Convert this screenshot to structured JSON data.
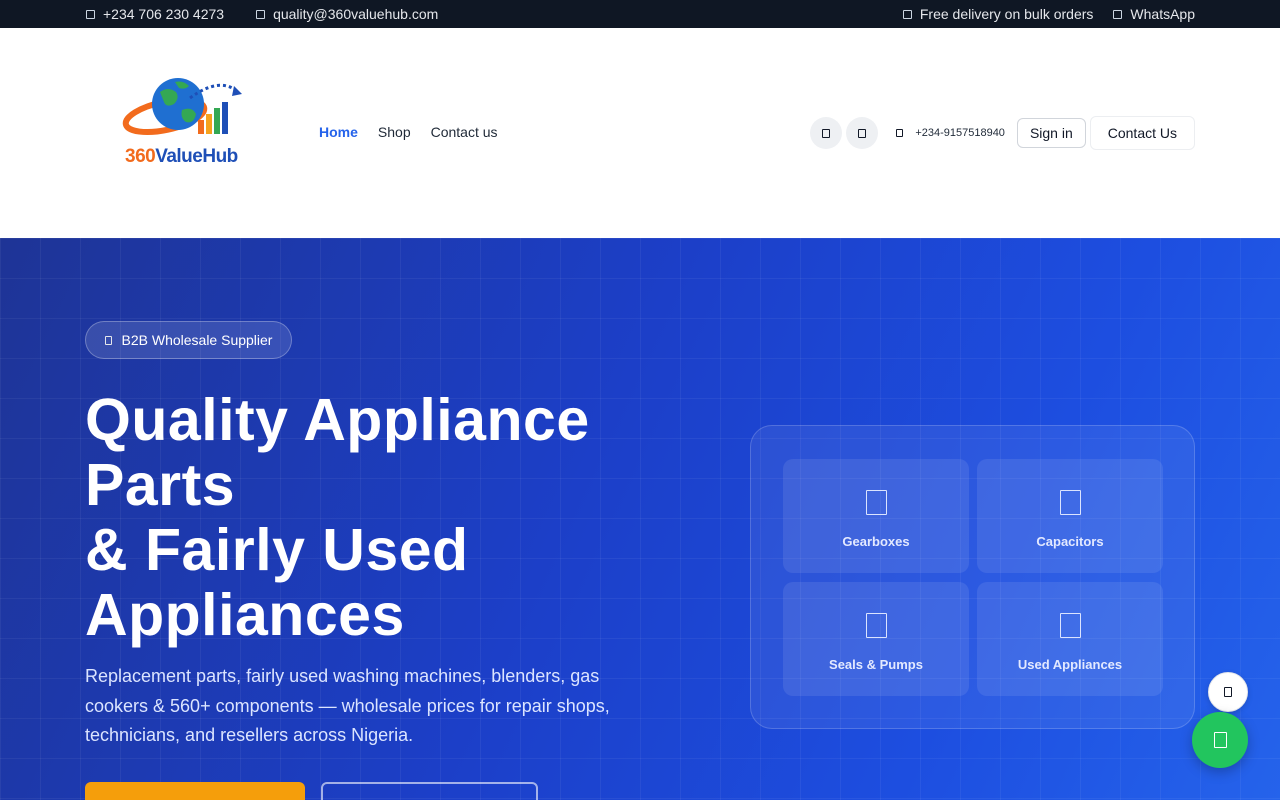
{
  "topbar": {
    "phone": "+234 706 230 4273",
    "email": "quality@360valuehub.com",
    "delivery": "Free delivery on bulk orders",
    "whatsapp": "WhatsApp"
  },
  "header": {
    "logo_part1": "360",
    "logo_part2": "ValueHub",
    "nav": [
      "Home",
      "Shop",
      "Contact us"
    ],
    "phone": "+234-9157518940",
    "signin": "Sign in",
    "contact": "Contact Us"
  },
  "hero": {
    "badge": "B2B Wholesale Supplier",
    "title_lines": [
      "Quality Appliance",
      "Parts",
      "& Fairly Used",
      "Appliances"
    ],
    "description": "Replacement parts, fairly used washing machines, blenders, gas cookers & 560+ components — wholesale prices for repair shops, technicians, and resellers across Nigeria.",
    "categories": [
      "Gearboxes",
      "Capacitors",
      "Seals & Pumps",
      "Used Appliances"
    ]
  },
  "colors": {
    "topbar_bg": "#0f1724",
    "accent": "#2563eb",
    "hero_blue": "#1d4ed8",
    "cta_orange": "#f59e0b",
    "whatsapp_green": "#22c55e",
    "logo_orange": "#f26b1d",
    "logo_blue": "#1e4fb7"
  },
  "icons": {
    "topbar_phone": "phone-icon",
    "topbar_email": "mail-icon",
    "topbar_delivery": "truck-icon",
    "topbar_whatsapp": "whatsapp-icon",
    "header_search": "search-icon",
    "header_cart": "cart-icon",
    "header_phone": "phone-icon",
    "badge": "briefcase-icon",
    "cat_gearboxes": "gear-icon",
    "cat_capacitors": "capacitor-icon",
    "cat_seals": "pump-icon",
    "cat_used": "appliance-icon",
    "float_top": "arrow-up-icon",
    "float_whatsapp": "whatsapp-icon"
  }
}
